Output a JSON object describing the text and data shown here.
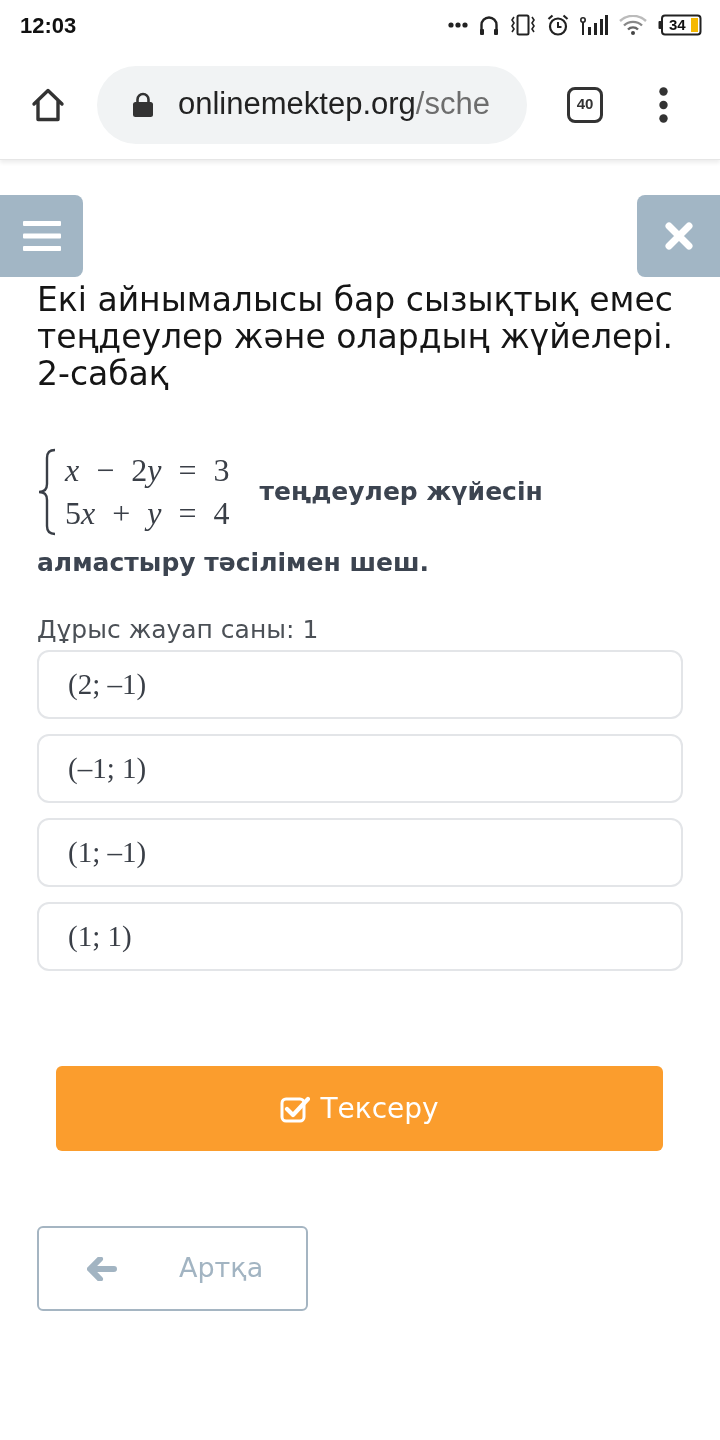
{
  "status_bar": {
    "time": "12:03",
    "battery": "34"
  },
  "browser": {
    "url_host": "onlinemektep.org",
    "url_path": "/sche",
    "tab_count": "40"
  },
  "lesson": {
    "title": "Екі айнымалысы бар сызықтық емес теңдеулер және олардың жүйелері. 2-сабақ"
  },
  "question": {
    "system": [
      "x − 2y = 3",
      "5x + y = 4"
    ],
    "prompt_lines": [
      "теңдеулер жүйесін",
      "алмастыру тәсілімен шеш."
    ],
    "answer_count": "Дұрыс жауап саны: 1"
  },
  "options": [
    {
      "label": "(2; –1)",
      "selected": false
    },
    {
      "label": "(–1; 1)",
      "selected": false
    },
    {
      "label": "(1; –1)",
      "selected": false
    },
    {
      "label": "(1; 1)",
      "selected": false
    }
  ],
  "buttons": {
    "check": "Тексеру",
    "back": "Артқа"
  }
}
